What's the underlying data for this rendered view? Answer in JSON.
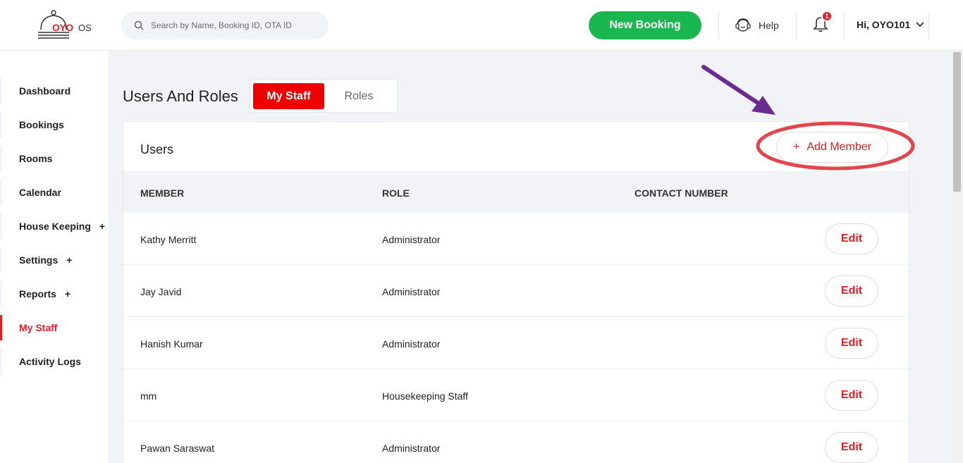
{
  "header": {
    "logo_text": "OYO",
    "logo_suffix": "OS",
    "search_placeholder": "Search by Name, Booking ID, OTA ID",
    "new_booking_label": "New Booking",
    "help_label": "Help",
    "notification_count": "1",
    "user_greeting": "Hi, OYO101"
  },
  "sidebar": {
    "items": [
      {
        "label": "Dashboard"
      },
      {
        "label": "Bookings"
      },
      {
        "label": "Rooms"
      },
      {
        "label": "Calendar"
      },
      {
        "label": "House Keeping",
        "expand": "+"
      },
      {
        "label": "Settings",
        "expand": "+"
      },
      {
        "label": "Reports",
        "expand": "+"
      },
      {
        "label": "My Staff"
      },
      {
        "label": "Activity Logs"
      }
    ]
  },
  "main": {
    "title": "Users And Roles",
    "tabs": [
      {
        "label": "My Staff"
      },
      {
        "label": "Roles"
      }
    ],
    "card_title": "Users",
    "add_member_icon": "+",
    "add_member_label": "Add Member",
    "columns": [
      "MEMBER",
      "ROLE",
      "CONTACT NUMBER"
    ],
    "rows": [
      {
        "member": "Kathy Merritt",
        "role": "Administrator",
        "contact": "",
        "action": "Edit"
      },
      {
        "member": "Jay Javid",
        "role": "Administrator",
        "contact": "",
        "action": "Edit"
      },
      {
        "member": "Hanish Kumar",
        "role": "Administrator",
        "contact": "",
        "action": "Edit"
      },
      {
        "member": "mm",
        "role": "Housekeeping Staff",
        "contact": "",
        "action": "Edit"
      },
      {
        "member": "Pawan Saraswat",
        "role": "Administrator",
        "contact": "",
        "action": "Edit"
      }
    ]
  },
  "colors": {
    "brand_red": "#e31e24",
    "green": "#1ab64f",
    "annotation_arrow": "#6a2c91",
    "annotation_circle": "#e0474c"
  }
}
